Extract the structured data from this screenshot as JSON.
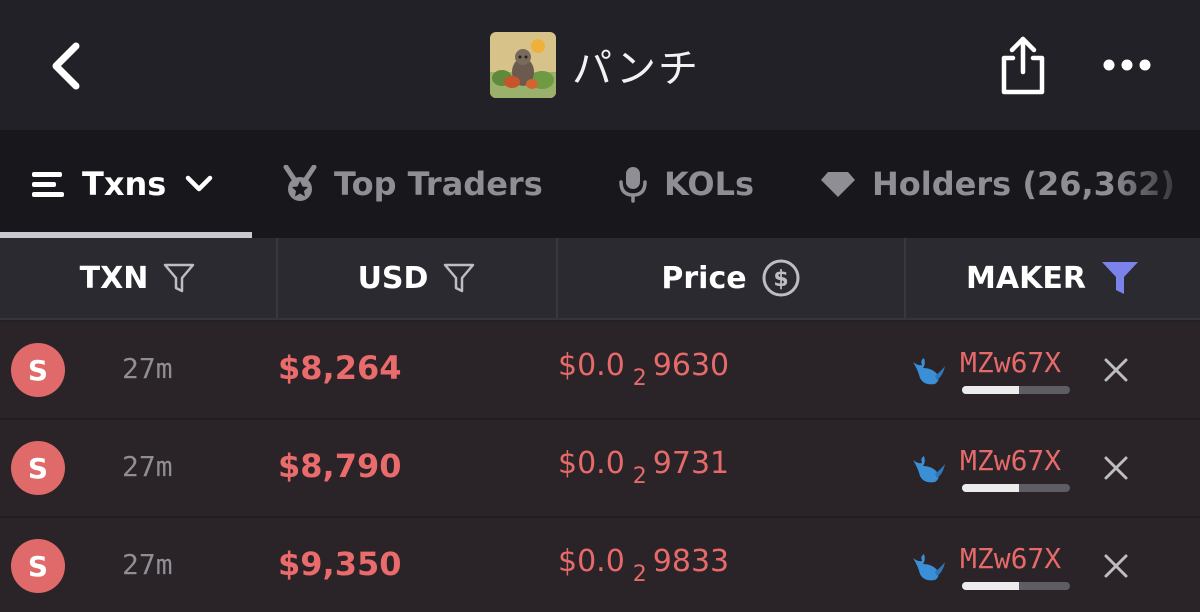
{
  "header": {
    "title": "パンチ",
    "back_icon": "chevron-left-icon",
    "share_icon": "share-icon",
    "more_icon": "ellipsis-icon",
    "token_image": "token-avatar"
  },
  "tabs": [
    {
      "label": "Txns",
      "active": true,
      "icon": "list-icon",
      "has_dropdown": true
    },
    {
      "label": "Top Traders",
      "active": false,
      "icon": "medal-icon"
    },
    {
      "label": "KOLs",
      "active": false,
      "icon": "microphone-icon"
    },
    {
      "label": "Holders (26,362)",
      "active": false,
      "icon": "diamond-icon"
    }
  ],
  "columns": {
    "txn": "TXN",
    "usd": "USD",
    "price": "Price",
    "maker": "MAKER"
  },
  "rows": [
    {
      "type": "S",
      "age": "27m",
      "usd": "$8,264",
      "price_prefix": "$0.0",
      "price_zeros": "2",
      "price_digits": "9630",
      "maker": "MZw67X",
      "maker_bar_fill": 0.53
    },
    {
      "type": "S",
      "age": "27m",
      "usd": "$8,790",
      "price_prefix": "$0.0",
      "price_zeros": "2",
      "price_digits": "9731",
      "maker": "MZw67X",
      "maker_bar_fill": 0.53
    },
    {
      "type": "S",
      "age": "27m",
      "usd": "$9,350",
      "price_prefix": "$0.0",
      "price_zeros": "2",
      "price_digits": "9833",
      "maker": "MZw67X",
      "maker_bar_fill": 0.53
    }
  ],
  "colors": {
    "sell": "#e06a6a",
    "maker_filter_active": "#7b83eb",
    "whale": "#3a8fd6"
  }
}
